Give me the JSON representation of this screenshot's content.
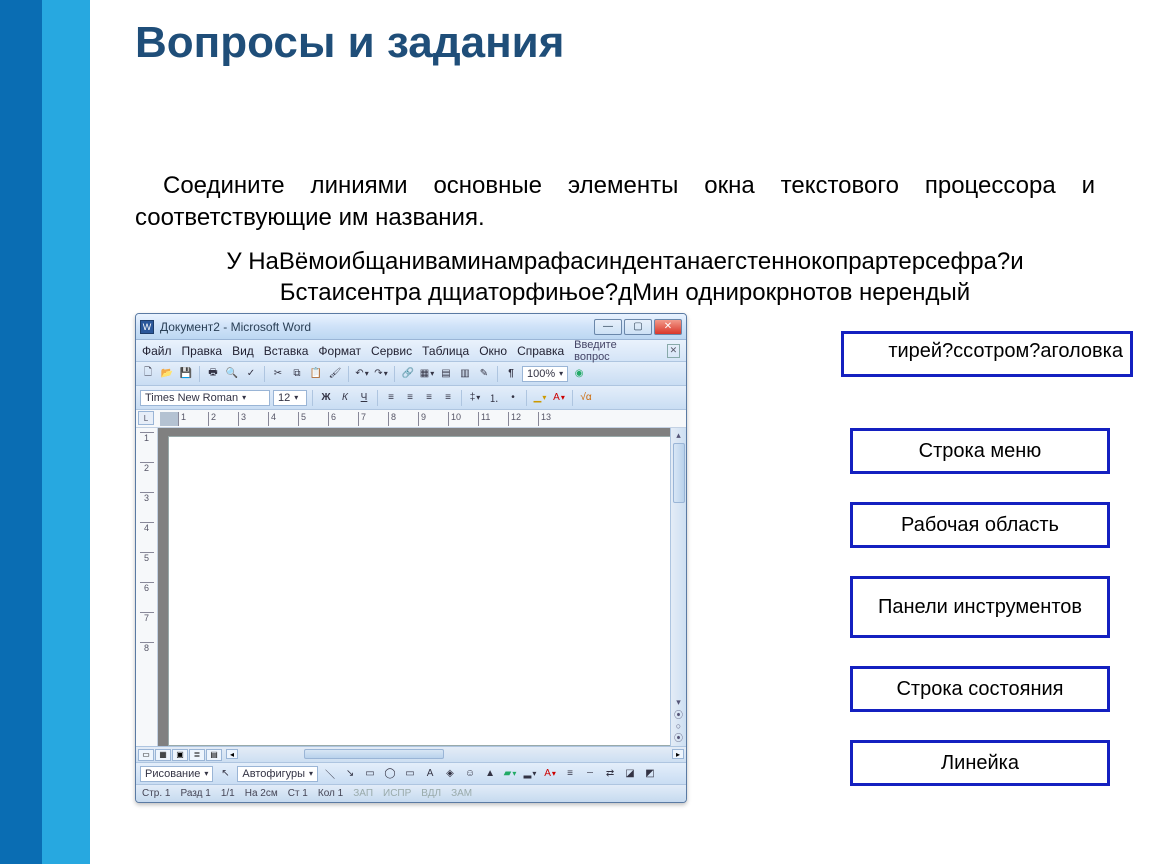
{
  "title": "Вопросы и задания",
  "task": "Соедините линиями основные элементы окна текстового процессора и соответствующие им названия.",
  "garbled_lines": [
    "У НаВёмоибщаниваминамрафасиндентанаегстеннокопрартерсефра?и",
    "Бстаисентра дщиаторфињое?дМин однирокрнотов нерендый",
    "тирей?ссотром?аголовка"
  ],
  "word": {
    "title": "Документ2 - Microsoft Word",
    "menu": [
      "Файл",
      "Правка",
      "Вид",
      "Вставка",
      "Формат",
      "Сервис",
      "Таблица",
      "Окно",
      "Справка"
    ],
    "help_hint": "Введите вопрос",
    "font_name": "Times New Roman",
    "font_size": "12",
    "bold": "Ж",
    "italic": "К",
    "underline": "Ч",
    "zoom": "100%",
    "ruler_label": "L",
    "ruler_ticks": [
      "",
      "1",
      "2",
      "3",
      "4",
      "5",
      "6",
      "7",
      "8",
      "9",
      "10",
      "11",
      "12",
      "13"
    ],
    "vruler_ticks": [
      "",
      "1",
      "2",
      "3",
      "4",
      "5",
      "6",
      "7",
      "8"
    ],
    "draw_label": "Рисование",
    "autoshapes": "Автофигуры",
    "status": {
      "page": "Стр. 1",
      "section": "Разд 1",
      "pages": "1/1",
      "at": "На 2см",
      "line": "Ст 1",
      "col": "Кол 1",
      "modes": [
        "ЗАП",
        "ИСПР",
        "ВДЛ",
        "ЗАМ"
      ]
    }
  },
  "answers": {
    "partial_tail": "аголовка",
    "items": [
      "Строка меню",
      "Рабочая область",
      "Панели инструментов",
      "Строка состояния",
      "Линейка"
    ]
  }
}
